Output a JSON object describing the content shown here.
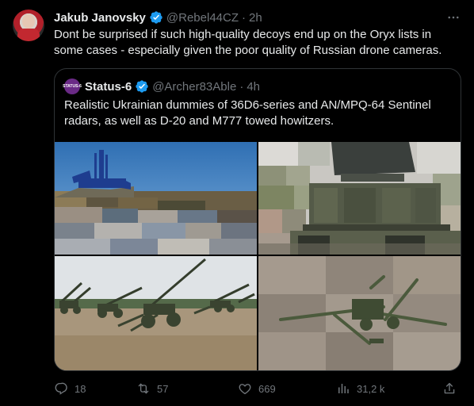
{
  "tweet": {
    "author_name": "Jakub Janovsky",
    "author_handle": "@Rebel44CZ",
    "separator": "·",
    "time": "2h",
    "text": "Dont be surprised if such high-quality decoys end up on the Oryx lists in some cases - especially given the poor quality of Russian drone cameras."
  },
  "quote": {
    "avatar_text": "STATUS-6",
    "author_name": "Status-6",
    "author_handle": "@Archer83Able",
    "separator": "·",
    "time": "4h",
    "text": "Realistic Ukrainian dummies of 36D6-series and AN/MPQ-64 Sentinel radars, as well as D-20 and M777 towed howitzers."
  },
  "actions": {
    "replies": "18",
    "reposts": "57",
    "likes": "669",
    "views": "31,2 k"
  },
  "colors": {
    "background": "#000000",
    "text_primary": "#e7e9ea",
    "text_secondary": "#71767b",
    "border": "#2f3336",
    "verified": "#1d9bf0"
  },
  "icons": [
    "more-icon",
    "verified-icon",
    "reply-icon",
    "repost-icon",
    "like-icon",
    "views-icon",
    "share-icon"
  ]
}
